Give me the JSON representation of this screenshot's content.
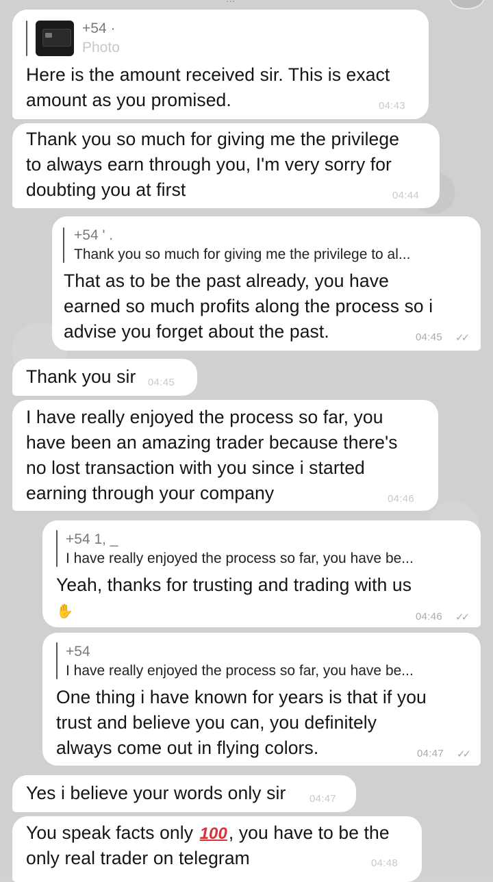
{
  "header": {
    "fragment_label": "...",
    "avatar": "avatar-stub"
  },
  "messages": [
    {
      "id": "m1",
      "direction": "incoming",
      "reply_sender": "+54 ·",
      "reply_preview": "Photo",
      "text": "Here is the amount received sir. This is exact\namount as you promised.",
      "time": "04:43"
    },
    {
      "id": "m2",
      "direction": "incoming",
      "text": "Thank you so much for giving me the privilege\nto always earn through you, I'm very sorry for\ndoubting you at first",
      "time": "04:44"
    },
    {
      "id": "m3",
      "direction": "outgoing",
      "reply_sender": "+54 ' .",
      "reply_preview": "Thank you so much for giving me the privilege to al...",
      "text": "That as to be the past already, you have\nearned so much profits along the process so i\nadvise you forget about the past.",
      "time": "04:45",
      "status_icon": "double-check-icon"
    },
    {
      "id": "m4",
      "direction": "incoming",
      "text": "Thank you sir",
      "time": "04:45"
    },
    {
      "id": "m5",
      "direction": "incoming",
      "text": "I have really enjoyed the process so far, you\nhave been an amazing trader because there's\nno lost transaction with you since i started\nearning through your company",
      "time": "04:46"
    },
    {
      "id": "m6",
      "direction": "outgoing",
      "reply_sender": "+54 1, _",
      "reply_preview": "I have really enjoyed the process so far, you have be...",
      "text": "Yeah, thanks for trusting and trading with us",
      "reaction_icon": "handshake-icon",
      "time": "04:46",
      "status_icon": "double-check-icon"
    },
    {
      "id": "m7",
      "direction": "outgoing",
      "reply_sender": "+54",
      "reply_preview": "I have really enjoyed the process so far, you have be...",
      "text": "One thing i have known for years is that if you\ntrust and believe you can, you definitely\nalways come out in flying colors.",
      "time": "04:47",
      "status_icon": "double-check-icon"
    },
    {
      "id": "m8",
      "direction": "incoming",
      "text": "Yes i believe your words only sir",
      "time": "04:47"
    },
    {
      "id": "m9",
      "direction": "incoming",
      "text_before_emoji": "You speak facts only ",
      "emoji": "💯",
      "text_after_emoji": ", you have to be the",
      "text_line2": "only real trader on telegram",
      "time": "04:48"
    }
  ],
  "colors": {
    "bubble": "#ffffff",
    "background": "#d0d0d0",
    "time_text": "#c9c9c9",
    "emoji_100": "#d8323a"
  }
}
